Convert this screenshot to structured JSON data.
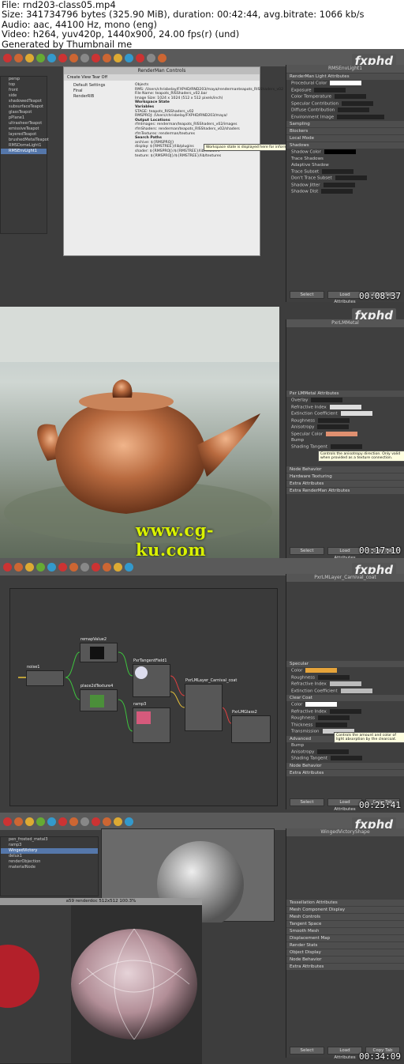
{
  "header": {
    "lines": [
      "File: rnd203-class05.mp4",
      "Size: 341734796 bytes (325.90 MiB), duration: 00:42:44, avg.bitrate: 1066 kb/s",
      "Audio: aac, 44100 Hz, mono (eng)",
      "Video: h264, yuv420p, 1440x900, 24.00 fps(r) (und)",
      "Generated by Thumbnail me"
    ]
  },
  "brand": "fxphd",
  "frames": [
    {
      "timestamp": "00:08:37",
      "outliner_items": [
        "persp",
        "top",
        "front",
        "side",
        "shadowedTeapot",
        "subsurfaceTeapot",
        "glassTeapot",
        "pPlane1",
        "ultrasheerTeapot",
        "emissiveTeapot",
        "layeredTeapot",
        "brushedMetalTeapot",
        "RMSDomeLight1",
        "RMSEnvLight1"
      ],
      "rman_title": "RenderMan Controls",
      "rman_menu": "Create  View  Tear Off",
      "rman_tabs": [
        "Default Settings",
        "Final",
        "RenderRIB"
      ],
      "rman_text": [
        "Objects",
        "RMS: /Users/chrisbelay/FXPHD/RND203/maya/rendermanteapots_RISShaders_v02",
        "File Name: teapots_RISShaders_v02.bar",
        "Image Size: 1024 x 1024 (512 x 512 pixels/inch)",
        "Workspace State",
        "Variables",
        "STAGE: teapots_RISShaders_v02",
        "RMSPROJ: /Users/chrisbelay/FXPHD/RND203/maya/",
        "Output Locations",
        "rfmImages: renderman/teapots_RISShaders_v02/images",
        "rfmShaders: renderman/teapots_RISShaders_v02/shaders",
        "rfmTextures: renderman/textures",
        "Search Paths",
        "archive: ${RMSPROJ}",
        "display: ${RMSTREE}/lib/plugins",
        "shader: ${RMSPROJ}/${RMSTREE}/lib/shaders",
        "texture: ${RMSPROJ}/${RMSTREE}/lib/textures"
      ],
      "tooltip": "Workspace state is displayed here for informational purposes and can only be edited in initialization files. See RMSWorkspace.ini",
      "ae_node": "RMSEnvLight1",
      "ae_sections": [
        "RenderMan Light Attributes",
        "Procedural Color",
        "Exposure",
        "Color Temperature",
        "Specular Contribution",
        "Diffuse Contribution",
        "Environment Image",
        "Sampling",
        "Blockers",
        "Local Mode",
        "Shadows",
        "Shadow Color",
        "Trace Shadows",
        "Adaptive Shadow",
        "Trace Subset",
        "Don't Trace Subset",
        "Shadow Jitter",
        "Shadow Dist"
      ],
      "buttons": [
        "Select",
        "Load Attributes",
        "Copy Tab"
      ]
    },
    {
      "timestamp": "00:17:10",
      "watermark": "www.cg-ku.com",
      "ae_node": "PxrLMMetal",
      "ae_sections": [
        "Pxr LMMetal Attributes",
        "Overlay",
        "Refractive Index",
        "Extinction Coefficient",
        "Roughness",
        "Anisotropy",
        "Specular Color",
        "Bump",
        "Shading Tangent",
        "Node Behavior",
        "Hardware Texturing",
        "Extra Attributes",
        "Extra RenderMan Attributes"
      ],
      "tooltip": "Controls the anisotropy direction. Only valid when provided as a texture connection.",
      "buttons": [
        "Select",
        "Load Attributes",
        "Copy Tab"
      ]
    },
    {
      "timestamp": "00:25:41",
      "nodes": [
        "noise1",
        "remapValue2",
        "PxrTangentField1",
        "PxrLMLayer_Carnival_coat",
        "place2dTexture4",
        "ramp3",
        "PxrLMGlass2"
      ],
      "ae_node": "PxrLMLayer_Carnival_coat",
      "ae_sections": [
        "Specular",
        "Color",
        "Roughness",
        "Refractive Index",
        "Extinction Coefficient",
        "Clear Coat",
        "Color",
        "Refractive Index",
        "Roughness",
        "Thickness",
        "Transmission",
        "Advanced",
        "Bump",
        "Anisotropy",
        "Shading Tangent",
        "Node Behavior",
        "Extra Attributes"
      ],
      "tooltip": "Controls the amount and color of light absorption by the clearcoat.",
      "buttons": [
        "Select",
        "Load Attributes",
        "Copy Tab"
      ]
    },
    {
      "timestamp": "00:34:09",
      "outliner_items": [
        "pen_frosted_metal3",
        "ramp3",
        "WingedVictory",
        "delux1",
        "renderObjection",
        "materialNode"
      ],
      "render_title": "a59 renderdoc 512x512 100.3%",
      "ae_node": "WingedVictoryShape",
      "ae_sections": [
        "Tessellation Attributes",
        "Mesh Component Display",
        "Mesh Controls",
        "Tangent Space",
        "Smooth Mesh",
        "Displacement Map",
        "Render Stats",
        "Object Display",
        "Node Behavior",
        "Extra Attributes"
      ],
      "buttons": [
        "Select",
        "Load Attributes",
        "Copy Tab"
      ]
    }
  ]
}
